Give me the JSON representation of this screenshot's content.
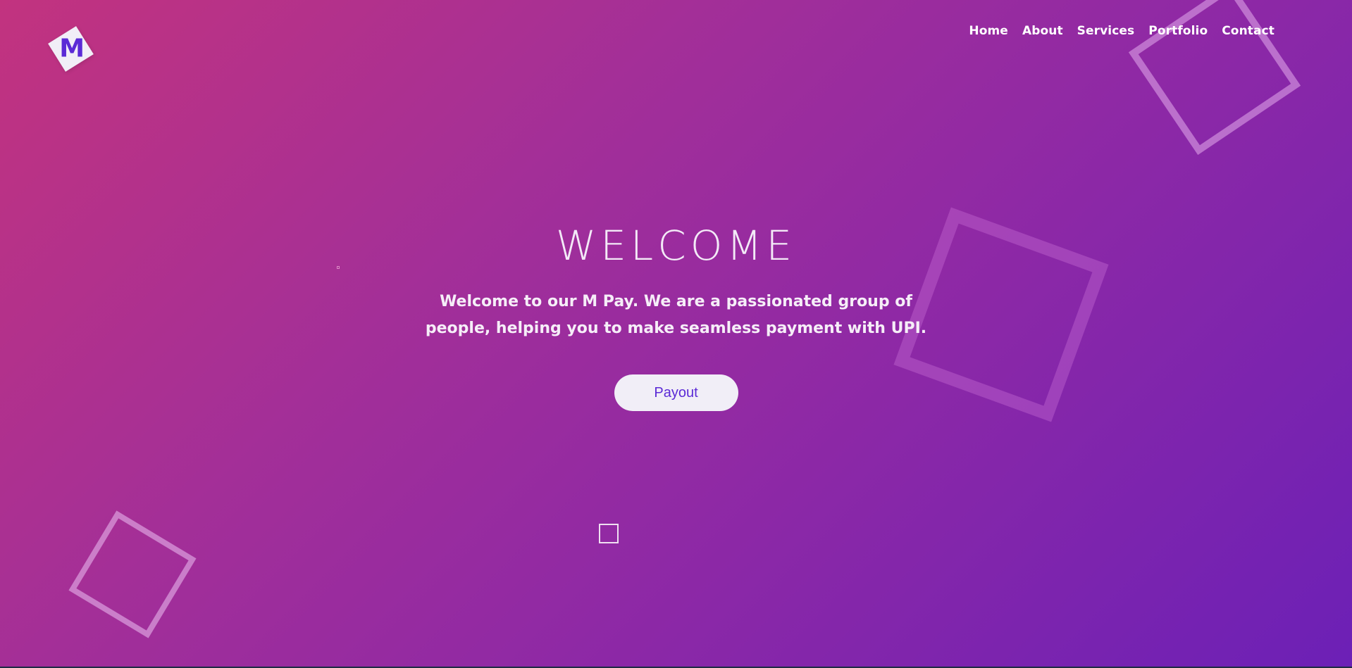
{
  "brand": {
    "logo_letter": "M"
  },
  "nav": {
    "items": [
      {
        "label": "Home"
      },
      {
        "label": "About"
      },
      {
        "label": "Services"
      },
      {
        "label": "Portfolio"
      },
      {
        "label": "Contact"
      }
    ]
  },
  "hero": {
    "title": "WELCOME",
    "text": "Welcome to our M Pay. We are a passionated group of people, helping you to make seamless payment with UPI.",
    "button_label": "Payout"
  },
  "colors": {
    "gradient_start": "#c2337f",
    "gradient_end": "#6c20b6",
    "accent": "#5b2ad6",
    "button_bg": "#f1eef7"
  }
}
